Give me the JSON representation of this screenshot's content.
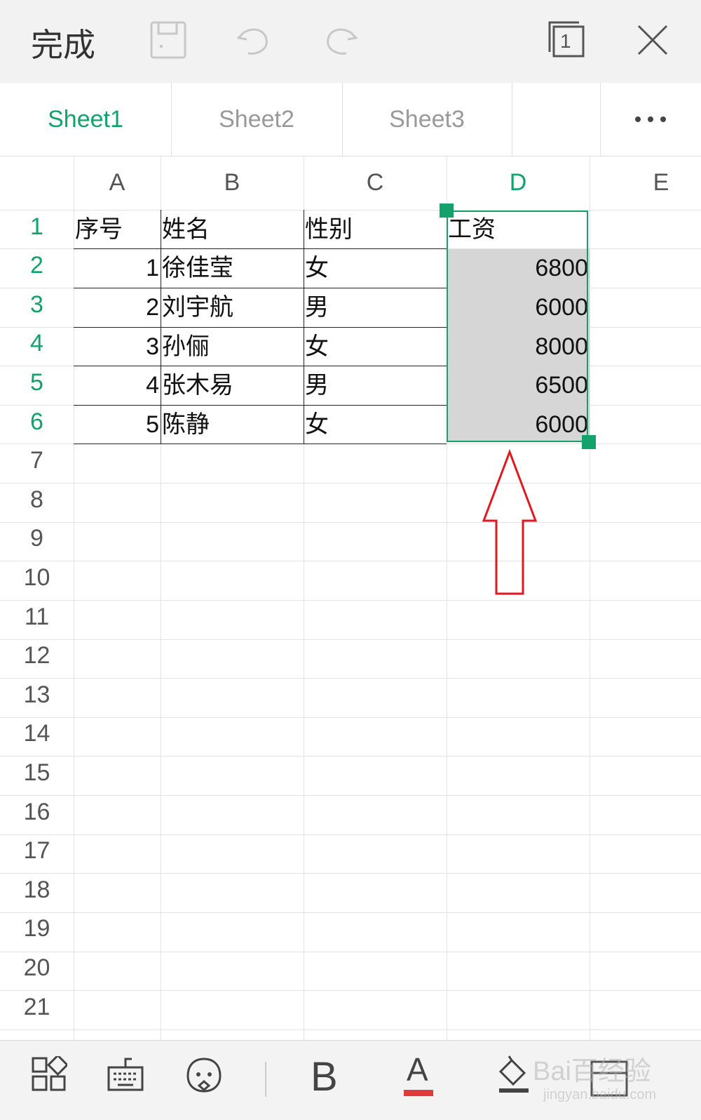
{
  "topbar": {
    "done_label": "完成",
    "sheets_count": "1"
  },
  "tabs": [
    {
      "label": "Sheet1",
      "active": true
    },
    {
      "label": "Sheet2",
      "active": false
    },
    {
      "label": "Sheet3",
      "active": false
    }
  ],
  "columns": [
    "A",
    "B",
    "C",
    "D",
    "E"
  ],
  "selected_column": "D",
  "rows": [
    "1",
    "2",
    "3",
    "4",
    "5",
    "6",
    "7",
    "8",
    "9",
    "10",
    "11",
    "12",
    "13",
    "14",
    "15",
    "16",
    "17",
    "18",
    "19",
    "20",
    "21"
  ],
  "cells": [
    [
      "序号",
      "姓名",
      "性别",
      "工资"
    ],
    [
      "1",
      "徐佳莹",
      "女",
      "6800"
    ],
    [
      "2",
      "刘宇航",
      "男",
      "6000"
    ],
    [
      "3",
      "孙俪",
      "女",
      "8000"
    ],
    [
      "4",
      "张木易",
      "男",
      "6500"
    ],
    [
      "5",
      "陈静",
      "女",
      "6000"
    ]
  ],
  "toolbar": {
    "bold_label": "B",
    "font_color_label": "A"
  },
  "colors": {
    "accent": "#13a26b",
    "arrow": "#e0181f",
    "font_color_bar": "#e03a3a"
  },
  "watermark": {
    "text": "Bai百经验",
    "sub": "jingyan.baidu.com"
  }
}
